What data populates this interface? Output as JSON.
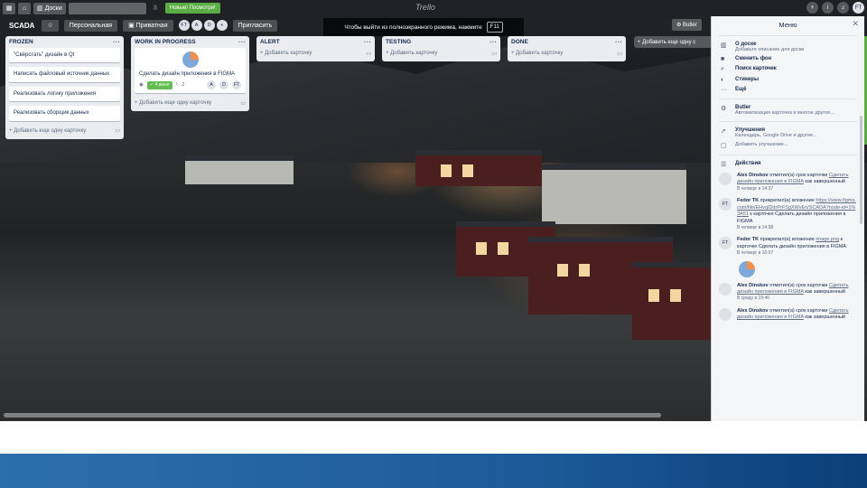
{
  "topbar": {
    "boards_label": "Доски",
    "new_badge": "Новые! Посмотри!",
    "logo": "Trello",
    "user_initials": "FT"
  },
  "board": {
    "title": "SCADA",
    "visibility": "Персональная",
    "access": "Приватная",
    "members": [
      "FT",
      "A",
      "D"
    ],
    "extra_members": "+",
    "invite_label": "Пригласить",
    "butler_label": "Butler"
  },
  "fullscreen_banner": {
    "text": "Чтобы выйти из полноэкранного режима, нажмите",
    "key": "F11"
  },
  "lists": [
    {
      "title": "FROZEN",
      "cards": [
        "\"Свёрстать\" дизайн в Qt",
        "Написать файловый источник данных",
        "Реализовать логику приложения",
        "Реализовать сборщик данных"
      ],
      "add_label": "Добавить еще одну карточку"
    },
    {
      "title": "WORK IN PROGRESS",
      "card": {
        "title": "Сделать дизайн приложения в FIGMA",
        "due": "4 июня",
        "attachments": "2",
        "members": [
          "A",
          "D",
          "FT"
        ]
      },
      "add_label": "Добавить еще одну карточку"
    },
    {
      "title": "ALERT",
      "add_label": "Добавить карточку"
    },
    {
      "title": "TESTING",
      "add_label": "Добавить карточку"
    },
    {
      "title": "DONE",
      "add_label": "Добавить карточку"
    }
  ],
  "add_list_label": "Добавить еще одну с",
  "menu": {
    "title": "Меню",
    "items": [
      {
        "icon": "board-icon",
        "label": "О доске",
        "sub": "Добавьте описание для доски"
      },
      {
        "icon": "background-icon",
        "label": "Сменить фон",
        "sub": ""
      },
      {
        "icon": "search-icon",
        "label": "Поиск карточек",
        "sub": ""
      },
      {
        "icon": "sticker-icon",
        "label": "Стикеры",
        "sub": ""
      },
      {
        "icon": "more-icon",
        "label": "Ещё",
        "sub": ""
      }
    ],
    "butler": {
      "label": "Butler",
      "sub": "Автоматизация карточек и многое другое..."
    },
    "powerups": {
      "label": "Улучшения",
      "sub": "Календарь, Google Drive и другие...",
      "add": "Добавить улучшение..."
    },
    "activity_title": "Действия",
    "activity": [
      {
        "avatar": "",
        "user": "Alex Dinskov",
        "text": "отметил(а) срок карточки",
        "link": "Сделать дизайн приложения в FIGMA",
        "tail": "как завершенный",
        "time": "В четверг в 14:37"
      },
      {
        "avatar": "FT",
        "user": "Fedor TK",
        "text": "прикрепил(а) вложение",
        "link": "https://www.figma.com/file/EHvqIDdrPrFSgXWvEn/SCADA?node-id=1%3A51",
        "tail": "к карточке Сделать дизайн приложения в FIGMA",
        "time": "В четверг в 14:58"
      },
      {
        "avatar": "FT",
        "user": "Fedor TK",
        "text": "прикрепил(а) вложение",
        "link": "image.png",
        "tail": "к карточке Сделать дизайн приложения в FIGMA",
        "time": "В четверг в 16:07"
      },
      {
        "avatar": "",
        "user": "Alex Dinskov",
        "text": "отметил(а) срок карточки",
        "link": "Сделать дизайн приложения в FIGMA",
        "tail": "как завершенный",
        "time": "В среду в 19:40"
      },
      {
        "avatar": "",
        "user": "Alex Dinskov",
        "text": "отметил(а) срок карточки",
        "link": "Сделать дизайн приложения в FIGMA",
        "tail": "как завершенный",
        "time": ""
      }
    ]
  }
}
